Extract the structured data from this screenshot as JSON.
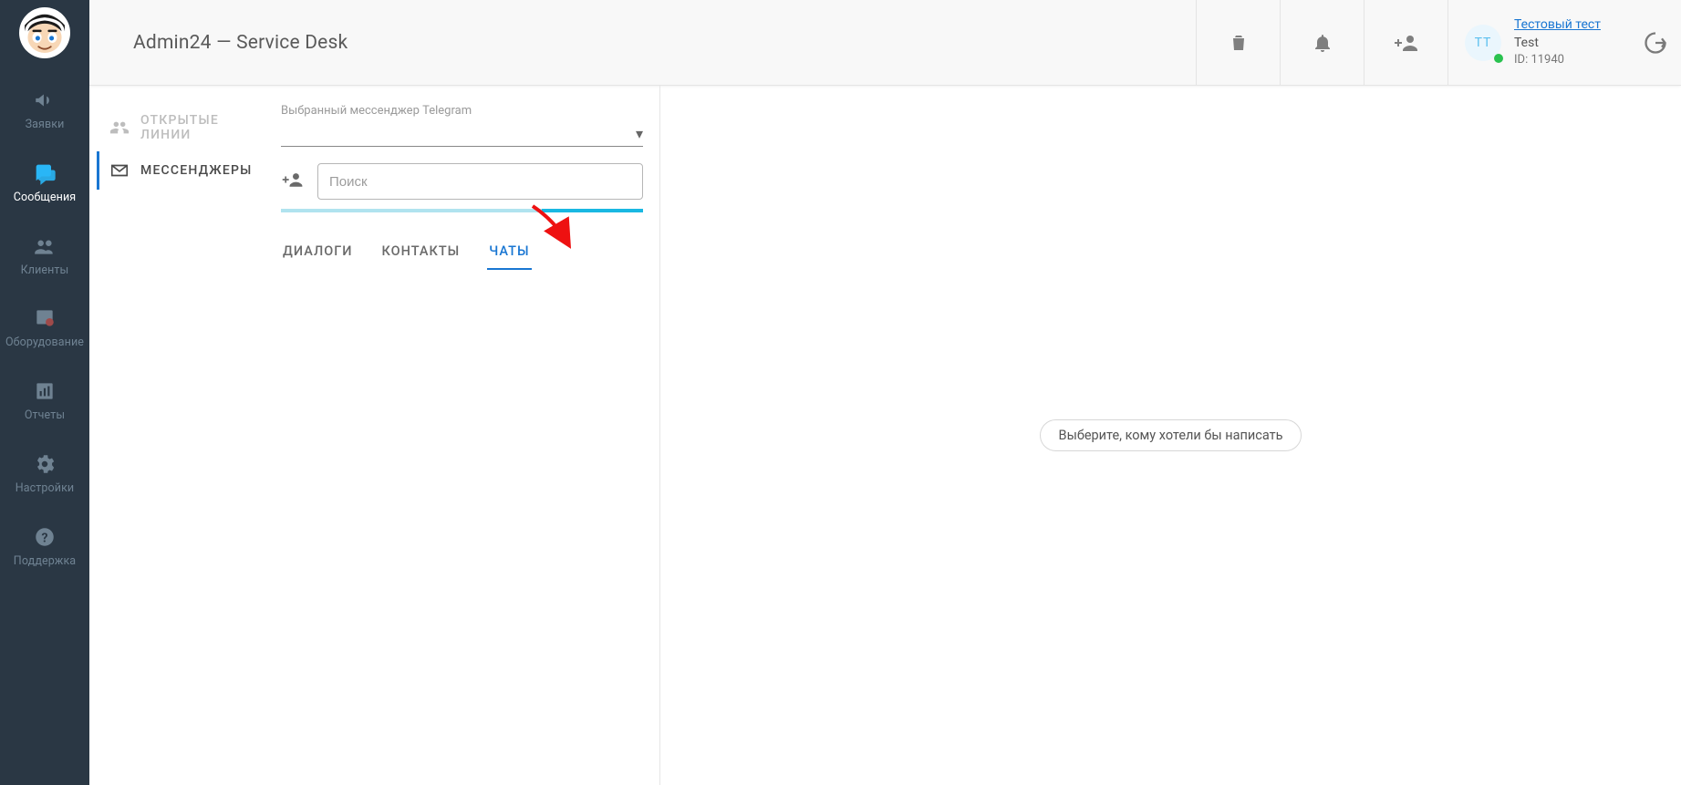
{
  "header": {
    "title": "Admin24 — Service Desk"
  },
  "user": {
    "initials": "ТТ",
    "name": "Тестовый тест",
    "company": "Test",
    "id_label": "ID: 11940"
  },
  "sidebar": {
    "items": [
      {
        "label": "Заявки"
      },
      {
        "label": "Сообщения"
      },
      {
        "label": "Клиенты"
      },
      {
        "label": "Оборудование"
      },
      {
        "label": "Отчеты"
      },
      {
        "label": "Настройки"
      },
      {
        "label": "Поддержка"
      }
    ],
    "active_index": 1
  },
  "channels": {
    "items": [
      {
        "label": "ОТКРЫТЫЕ ЛИНИИ"
      },
      {
        "label": "МЕССЕНДЖЕРЫ"
      }
    ],
    "active_index": 1
  },
  "messenger": {
    "selector_label": "Выбранный мессенджер Telegram",
    "search_placeholder": "Поиск"
  },
  "tabs": {
    "items": [
      {
        "label": "ДИАЛОГИ"
      },
      {
        "label": "КОНТАКТЫ"
      },
      {
        "label": "ЧАТЫ"
      }
    ],
    "active_index": 2
  },
  "empty_state": {
    "text": "Выберите, кому хотели бы написать"
  }
}
